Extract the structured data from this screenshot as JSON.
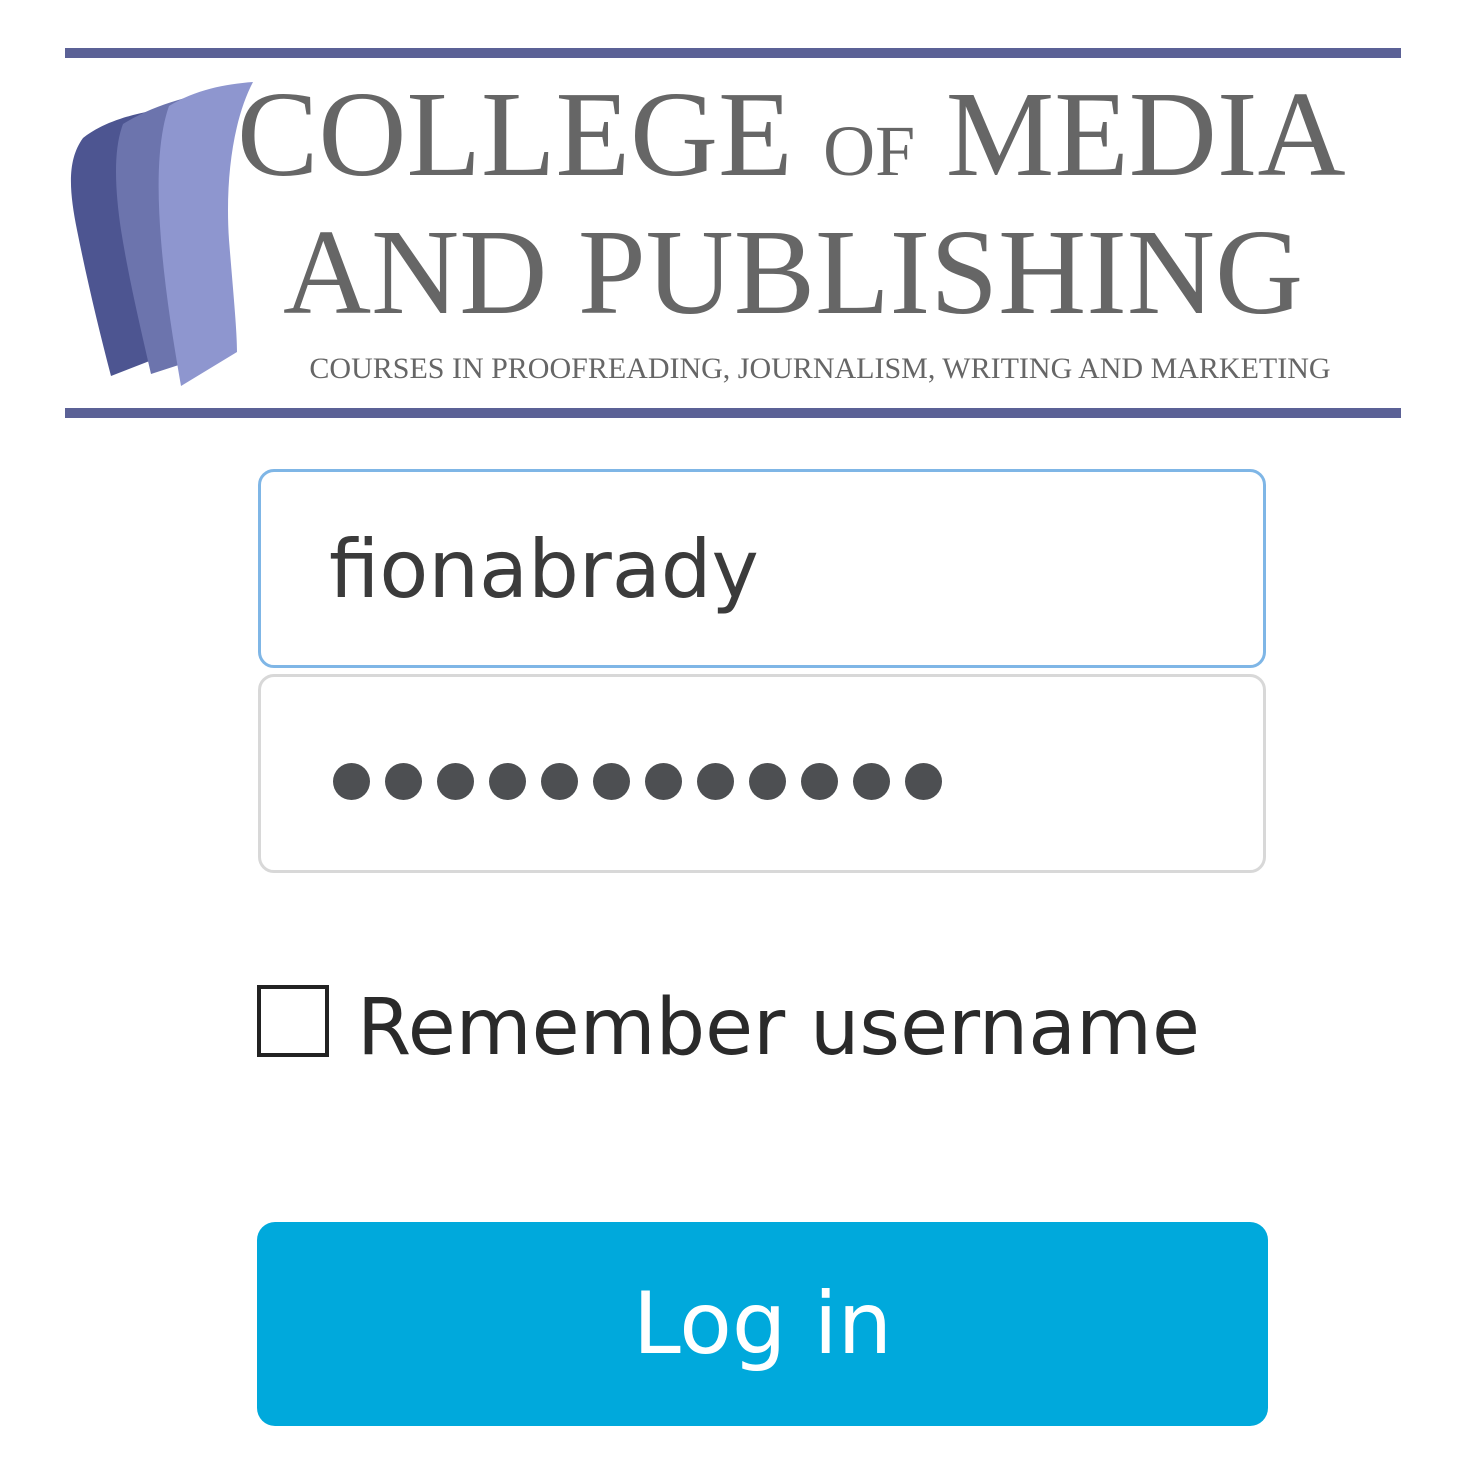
{
  "logo": {
    "line1_main": "COLLEGE",
    "line1_small": "OF",
    "line1_end": "MEDIA",
    "line2": "AND PUBLISHING",
    "tagline": "COURSES IN PROOFREADING, JOURNALISM, WRITING AND MARKETING",
    "rule_color": "#5b6196",
    "mark_colors": [
      "#4d5591",
      "#6c74ad",
      "#8e96cf"
    ]
  },
  "login": {
    "username_value": "fionabrady",
    "password_masked_length": 12,
    "remember_label": "Remember username",
    "remember_checked": false,
    "submit_label": "Log in",
    "button_color": "#00a9dc",
    "focus_border_color": "#7fb6e6"
  }
}
